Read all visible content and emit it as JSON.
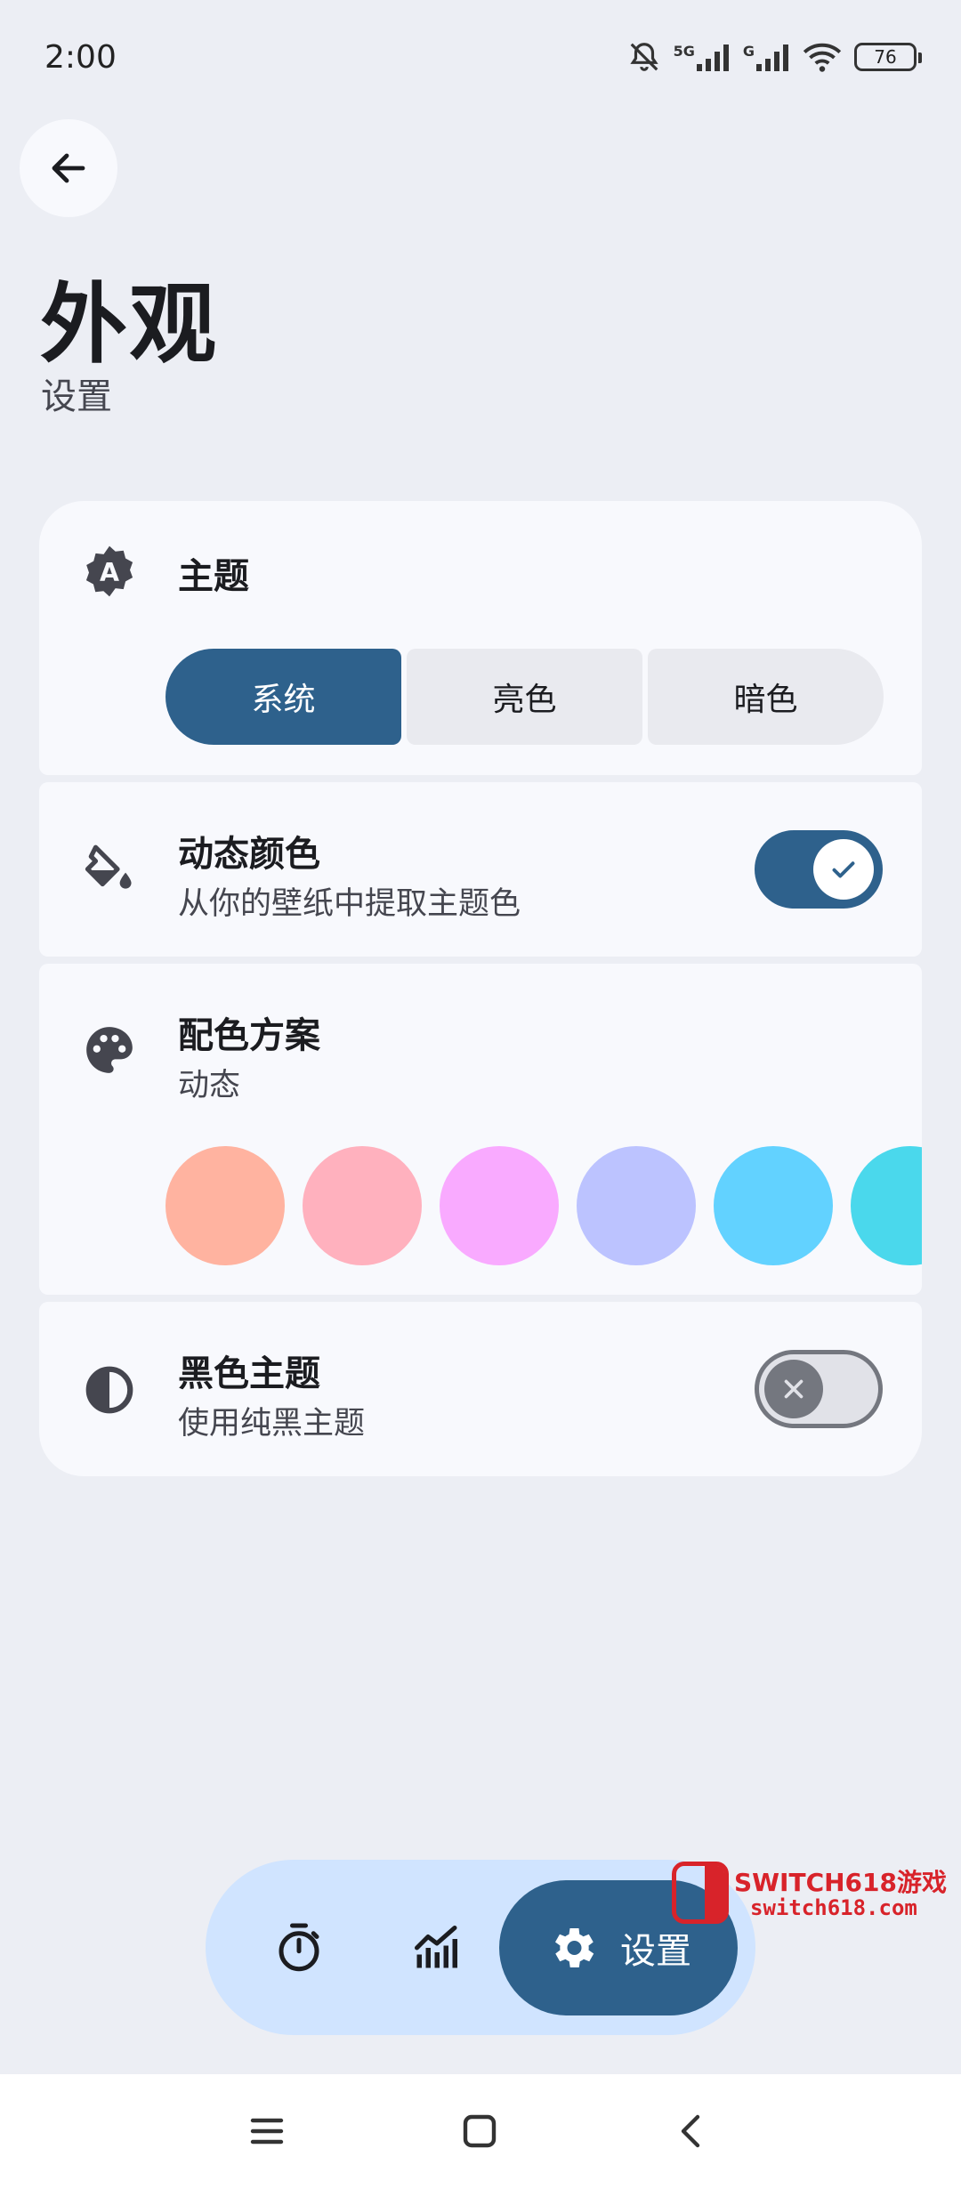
{
  "status_bar": {
    "time": "2:00",
    "battery": "76",
    "network_1": "5G",
    "network_2": "G"
  },
  "header": {
    "title": "外观",
    "subtitle": "设置"
  },
  "theme": {
    "label": "主题",
    "options": [
      "系统",
      "亮色",
      "暗色"
    ],
    "selected": "系统"
  },
  "dynamic_color": {
    "title": "动态颜色",
    "description": "从你的壁纸中提取主题色",
    "enabled": true
  },
  "color_scheme": {
    "title": "配色方案",
    "value": "动态",
    "swatches": [
      "#ffb3a0",
      "#ffb1be",
      "#f9aaff",
      "#bcc3ff",
      "#62d2ff",
      "#4ad8ec"
    ]
  },
  "black_theme": {
    "title": "黑色主题",
    "description": "使用纯黑主题",
    "enabled": false
  },
  "bottom_nav": {
    "settings_label": "设置",
    "active": "settings"
  },
  "watermark": {
    "line1": "SWITCH618游戏",
    "line2": "switch618.com"
  },
  "colors": {
    "primary": "#2e618c",
    "background": "#eceef4",
    "surface": "#f8f9fd",
    "nav_container": "#d0e4ff"
  }
}
